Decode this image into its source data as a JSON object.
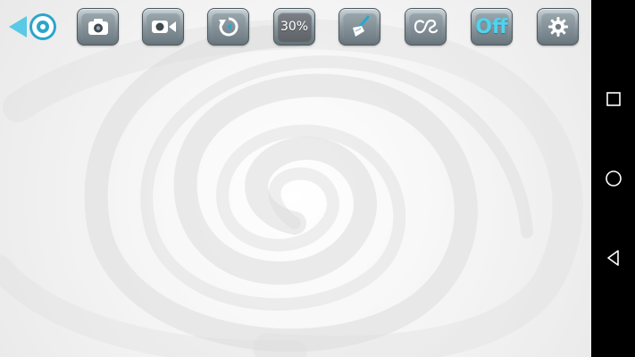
{
  "toolbar": {
    "buttons": [
      {
        "name": "back-eye-button",
        "icon": "eye-back-arrow-icon"
      },
      {
        "name": "photo-button",
        "icon": "camera-icon"
      },
      {
        "name": "video-button",
        "icon": "video-camera-icon"
      },
      {
        "name": "rotate-button",
        "icon": "rotate-icon"
      },
      {
        "name": "zoom-percent-button",
        "label": "30%"
      },
      {
        "name": "clean-button",
        "icon": "broom-icon"
      },
      {
        "name": "lastfm-button",
        "icon": "lastfm-icon"
      },
      {
        "name": "toggle-button",
        "label": "Off"
      },
      {
        "name": "settings-button",
        "icon": "gear-icon"
      }
    ]
  },
  "colors": {
    "accent": "#4fd3ee",
    "button_frame": "#4e5a60",
    "background": "#f4f4f4",
    "nav_bar": "#000000"
  },
  "navbar": {
    "items": [
      {
        "name": "nav-recent-apps",
        "icon": "square-icon"
      },
      {
        "name": "nav-home",
        "icon": "circle-icon"
      },
      {
        "name": "nav-back",
        "icon": "triangle-back-icon"
      }
    ]
  }
}
